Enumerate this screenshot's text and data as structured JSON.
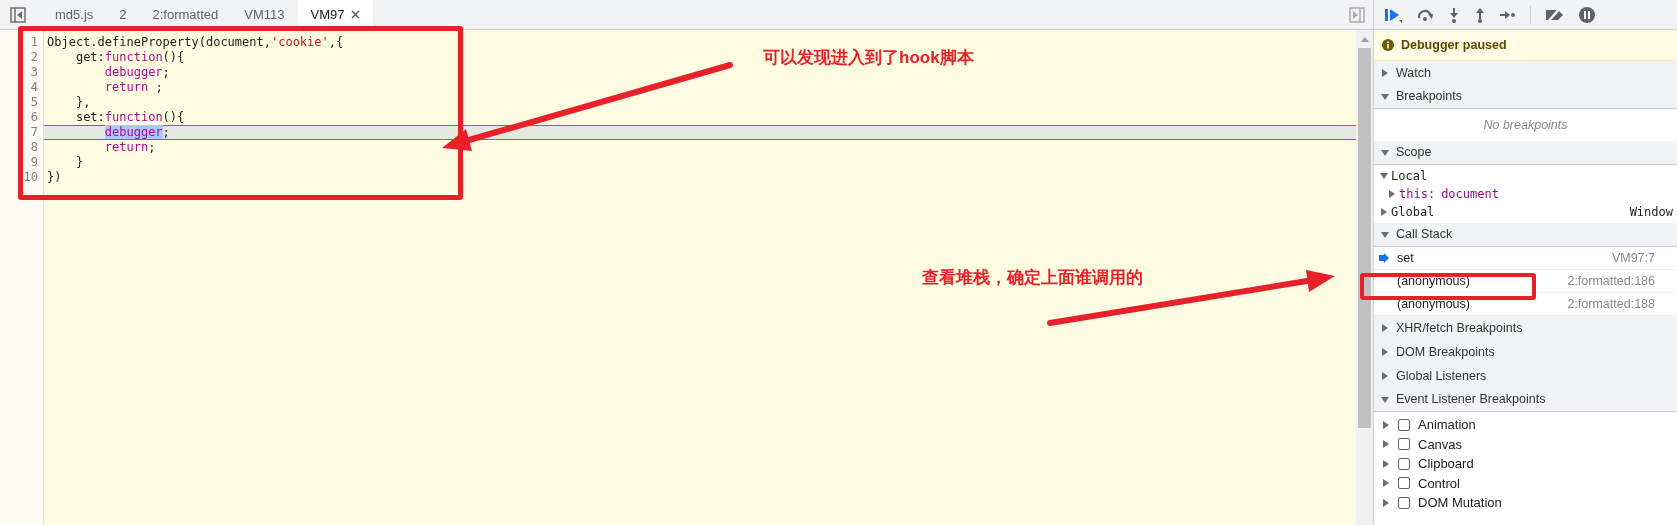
{
  "tabs": [
    {
      "label": "md5.js",
      "selected": false
    },
    {
      "label": "2",
      "selected": false
    },
    {
      "label": "2:formatted",
      "selected": false
    },
    {
      "label": "VM113",
      "selected": false
    },
    {
      "label": "VM97",
      "selected": true
    }
  ],
  "code": {
    "lines": [
      {
        "number": "1",
        "current": false,
        "tokens": [
          {
            "text": "Object.defineProperty(document,",
            "kind": "plain"
          },
          {
            "text": "'cookie'",
            "kind": "string"
          },
          {
            "text": ",{",
            "kind": "plain"
          }
        ]
      },
      {
        "number": "2",
        "current": false,
        "tokens": [
          {
            "text": "    get:",
            "kind": "plain"
          },
          {
            "text": "function",
            "kind": "keyword"
          },
          {
            "text": "(){",
            "kind": "plain"
          }
        ]
      },
      {
        "number": "3",
        "current": false,
        "tokens": [
          {
            "text": "        debugger",
            "kind": "keyword"
          },
          {
            "text": ";",
            "kind": "plain"
          }
        ]
      },
      {
        "number": "4",
        "current": false,
        "tokens": [
          {
            "text": "        return",
            "kind": "keyword"
          },
          {
            "text": " ;",
            "kind": "plain"
          }
        ]
      },
      {
        "number": "5",
        "current": false,
        "tokens": [
          {
            "text": "    },",
            "kind": "plain"
          }
        ]
      },
      {
        "number": "6",
        "current": false,
        "tokens": [
          {
            "text": "    set:",
            "kind": "plain"
          },
          {
            "text": "function",
            "kind": "keyword"
          },
          {
            "text": "(){",
            "kind": "plain"
          }
        ]
      },
      {
        "number": "7",
        "current": true,
        "tokens": [
          {
            "text": "        debugger",
            "kind": "keyword",
            "selected": true
          },
          {
            "text": ";",
            "kind": "plain"
          }
        ]
      },
      {
        "number": "8",
        "current": false,
        "tokens": [
          {
            "text": "        return",
            "kind": "keyword"
          },
          {
            "text": ";",
            "kind": "plain"
          }
        ]
      },
      {
        "number": "9",
        "current": false,
        "tokens": [
          {
            "text": "    }",
            "kind": "plain"
          }
        ]
      },
      {
        "number": "10",
        "current": false,
        "tokens": [
          {
            "text": "})",
            "kind": "plain"
          }
        ]
      }
    ]
  },
  "annotations": [
    {
      "text": "可以发现进入到了hook脚本"
    },
    {
      "text": "查看堆栈，确定上面谁调用的"
    }
  ],
  "sidebar": {
    "banner": "Debugger paused",
    "sections": [
      {
        "title": "Watch",
        "expanded": false
      },
      {
        "kind": "breakpoints",
        "title": "Breakpoints",
        "expanded": true,
        "empty_text": "No breakpoints"
      },
      {
        "kind": "scope",
        "title": "Scope",
        "expanded": true,
        "items": [
          {
            "name": "Local",
            "expanded": true,
            "children": [
              {
                "key": "this:",
                "value": "document",
                "expanded": false
              }
            ]
          },
          {
            "name": "Global",
            "expanded": false,
            "value": "Window"
          }
        ]
      },
      {
        "kind": "call_stack",
        "title": "Call Stack",
        "expanded": true,
        "frames": [
          {
            "function": "set",
            "location": "VM97:7",
            "current": true
          },
          {
            "function": "(anonymous)",
            "location": "2:formatted:186",
            "current": false
          },
          {
            "function": "(anonymous)",
            "location": "2:formatted:188",
            "current": false
          }
        ]
      },
      {
        "title": "XHR/fetch Breakpoints",
        "expanded": false
      },
      {
        "title": "DOM Breakpoints",
        "expanded": false
      },
      {
        "title": "Global Listeners",
        "expanded": false
      },
      {
        "kind": "event_listeners",
        "title": "Event Listener Breakpoints",
        "expanded": true,
        "items": [
          {
            "label": "Animation",
            "checked": false,
            "expanded": false
          },
          {
            "label": "Canvas",
            "checked": false,
            "expanded": false
          },
          {
            "label": "Clipboard",
            "checked": false,
            "expanded": false
          },
          {
            "label": "Control",
            "checked": false,
            "expanded": false
          },
          {
            "label": "DOM Mutation",
            "checked": false,
            "expanded": false
          }
        ]
      }
    ]
  }
}
